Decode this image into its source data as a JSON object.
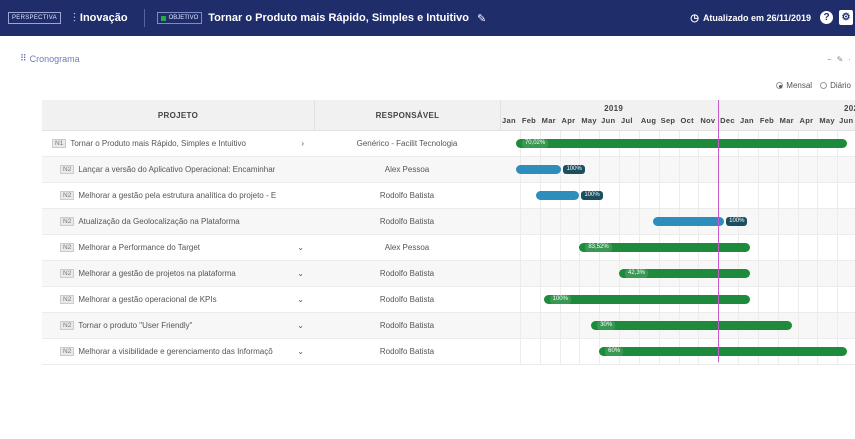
{
  "topbar": {
    "perspective_tag": "PERSPECTIVA",
    "perspective_name": "Inovação",
    "objective_tag": "OBJETIVO",
    "objective_name": "Tornar o Produto mais Rápido, Simples e Intuitivo",
    "updated_text": "Atualizado em 26/11/2019",
    "help_label": "?",
    "settings_label": "⚙"
  },
  "section": {
    "title": "Cronograma",
    "view_options": [
      "Mensal",
      "Diário"
    ],
    "selected_view": "Mensal"
  },
  "table": {
    "headers": {
      "project": "PROJETO",
      "responsible": "RESPONSÁVEL"
    },
    "years": [
      "2019",
      "202"
    ],
    "months": [
      "Jan",
      "Feb",
      "Mar",
      "Apr",
      "May",
      "Jun",
      "Jul",
      "Aug",
      "Sep",
      "Oct",
      "Nov",
      "Dec",
      "Jan",
      "Feb",
      "Mar",
      "Apr",
      "May",
      "Jun"
    ],
    "rows": [
      {
        "level": "N1",
        "project": "Tornar o Produto mais Rápido, Simples e Intuitivo",
        "responsible": "Genérico - Facilit Tecnologia",
        "arrow": "›",
        "start_month": 0.8,
        "end_month": 17.5,
        "percent": "70,02%",
        "color": "green"
      },
      {
        "level": "N2",
        "project": "Lançar a versão do Aplicativo Operacional: Encaminhar",
        "responsible": "Alex Pessoa",
        "arrow": "",
        "start_month": 0.8,
        "end_month": 3.1,
        "percent": "100%",
        "color": "blue"
      },
      {
        "level": "N2",
        "project": "Melhorar a gestão pela estrutura analítica do projeto - E",
        "responsible": "Rodolfo Batista",
        "arrow": "",
        "start_month": 1.8,
        "end_month": 4.0,
        "percent": "100%",
        "color": "blue"
      },
      {
        "level": "N2",
        "project": "Atualização da Geolocalização na Plataforma",
        "responsible": "Rodolfo Batista",
        "arrow": "",
        "start_month": 7.7,
        "end_month": 11.3,
        "percent": "100%",
        "color": "blue"
      },
      {
        "level": "N2",
        "project": "Melhorar a Performance do Target",
        "responsible": "Alex Pessoa",
        "arrow": "⌄",
        "start_month": 4.0,
        "end_month": 12.6,
        "percent": "83,52%",
        "color": "green"
      },
      {
        "level": "N2",
        "project": "Melhorar a gestão de projetos na plataforma",
        "responsible": "Rodolfo Batista",
        "arrow": "⌄",
        "start_month": 6.0,
        "end_month": 12.6,
        "percent": "42,3%",
        "color": "green"
      },
      {
        "level": "N2",
        "project": "Melhorar a gestão operacional de KPIs",
        "responsible": "Rodolfo Batista",
        "arrow": "⌄",
        "start_month": 2.2,
        "end_month": 12.6,
        "percent": "100%",
        "color": "green"
      },
      {
        "level": "N2",
        "project": "Tornar o produto \"User Friendly\"",
        "responsible": "Rodolfo Batista",
        "arrow": "⌄",
        "start_month": 4.6,
        "end_month": 14.7,
        "percent": "30%",
        "color": "green"
      },
      {
        "level": "N2",
        "project": "Melhorar a visibilidade e gerenciamento das Informaçõ",
        "responsible": "Rodolfo Batista",
        "arrow": "⌄",
        "start_month": 5.0,
        "end_month": 17.5,
        "percent": "60%",
        "color": "green"
      }
    ],
    "today_month": 11.0
  },
  "colors": {
    "topbar": "#1f2d6b",
    "bar_green": "#1e8a3c",
    "bar_blue": "#2e8dbb",
    "today_line": "#c85ad0"
  }
}
